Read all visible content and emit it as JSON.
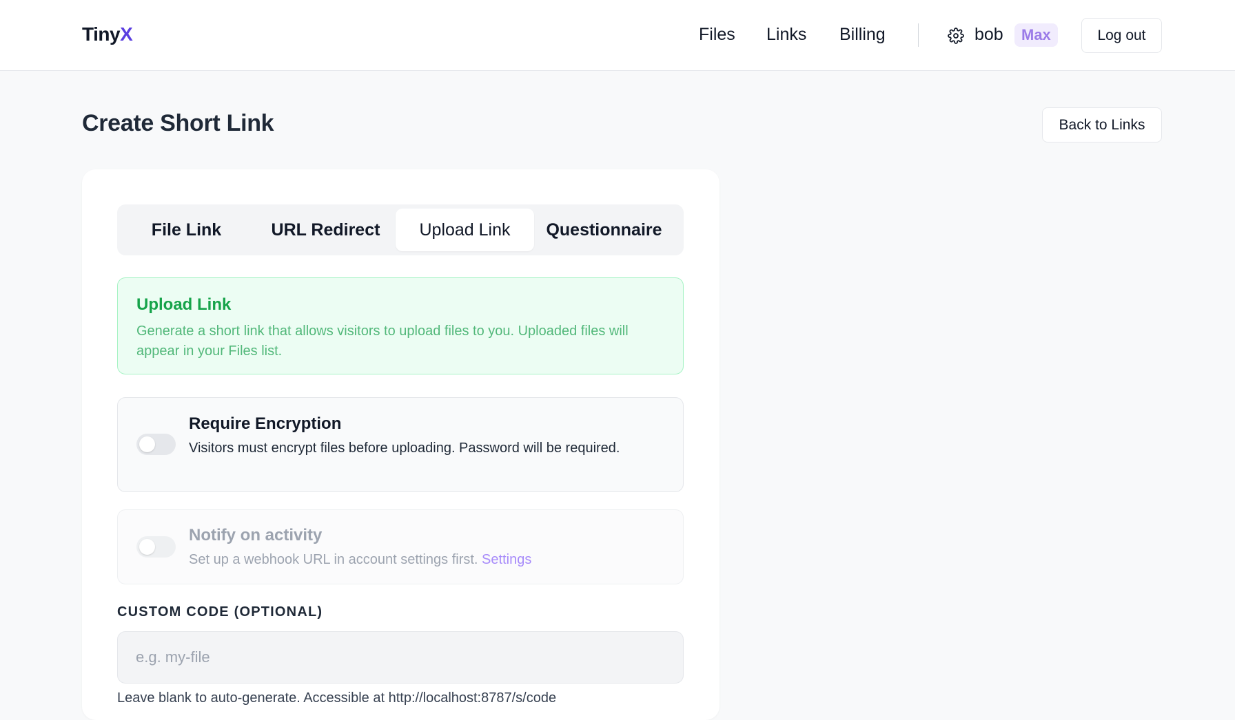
{
  "header": {
    "logo_main": "Tiny",
    "logo_accent": "X",
    "nav": [
      "Files",
      "Links",
      "Billing"
    ],
    "username": "bob",
    "plan": "Max",
    "logout_label": "Log out",
    "accent_color": "#5b3fe0"
  },
  "page": {
    "title": "Create Short Link",
    "back_label": "Back to Links"
  },
  "tabs": [
    {
      "label": "File Link",
      "active": false
    },
    {
      "label": "URL Redirect",
      "active": false
    },
    {
      "label": "Upload Link",
      "active": true
    },
    {
      "label": "Questionnaire",
      "active": false
    }
  ],
  "info": {
    "title": "Upload Link",
    "description": "Generate a short link that allows visitors to upload files to you. Uploaded files will appear in your Files list."
  },
  "options": {
    "encryption": {
      "title": "Require Encryption",
      "description": "Visitors must encrypt files before uploading. Password will be required.",
      "enabled": false
    },
    "notify": {
      "title": "Notify on activity",
      "description": "Set up a webhook URL in account settings first.",
      "link_label": "Settings",
      "enabled": false,
      "disabled": true
    }
  },
  "custom_code": {
    "label": "CUSTOM CODE (OPTIONAL)",
    "value": "",
    "placeholder": "e.g. my-file",
    "help": "Leave blank to auto-generate. Accessible at http://localhost:8787/s/code"
  }
}
